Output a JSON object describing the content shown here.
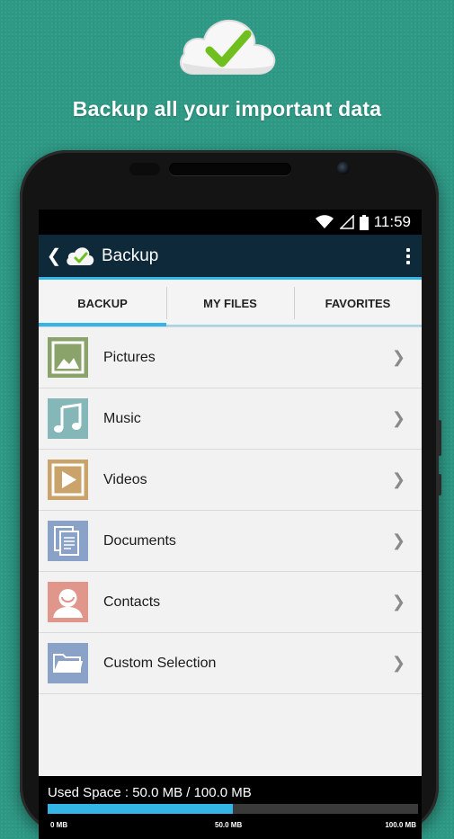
{
  "promo": {
    "headline": "Backup all your important data",
    "logo_icon": "cloud-check-icon"
  },
  "status_bar": {
    "time": "11:59",
    "icons": [
      "wifi-icon",
      "signal-icon",
      "battery-icon"
    ]
  },
  "app_bar": {
    "title": "Backup",
    "back_icon": "chevron-left-icon",
    "menu_icon": "overflow-menu-icon"
  },
  "tabs": [
    {
      "label": "BACKUP",
      "active": true
    },
    {
      "label": "MY FILES",
      "active": false
    },
    {
      "label": "FAVORITES",
      "active": false
    }
  ],
  "items": [
    {
      "label": "Pictures",
      "icon": "image-icon",
      "color": "#8aa36a"
    },
    {
      "label": "Music",
      "icon": "music-note-icon",
      "color": "#86b7b8"
    },
    {
      "label": "Videos",
      "icon": "play-icon",
      "color": "#c9a36a"
    },
    {
      "label": "Documents",
      "icon": "documents-icon",
      "color": "#8aa1c8"
    },
    {
      "label": "Contacts",
      "icon": "contact-icon",
      "color": "#e0968a"
    },
    {
      "label": "Custom Selection",
      "icon": "folder-icon",
      "color": "#8aa1c8"
    }
  ],
  "storage": {
    "text": "Used Space : 50.0 MB / 100.0 MB",
    "used_fraction": 0.5,
    "min_label": "0 MB",
    "mid_label": "50.0 MB",
    "max_label": "100.0 MB"
  },
  "colors": {
    "background": "#2e9a86",
    "app_bar": "#0e2a3a",
    "accent": "#33b5e5"
  }
}
